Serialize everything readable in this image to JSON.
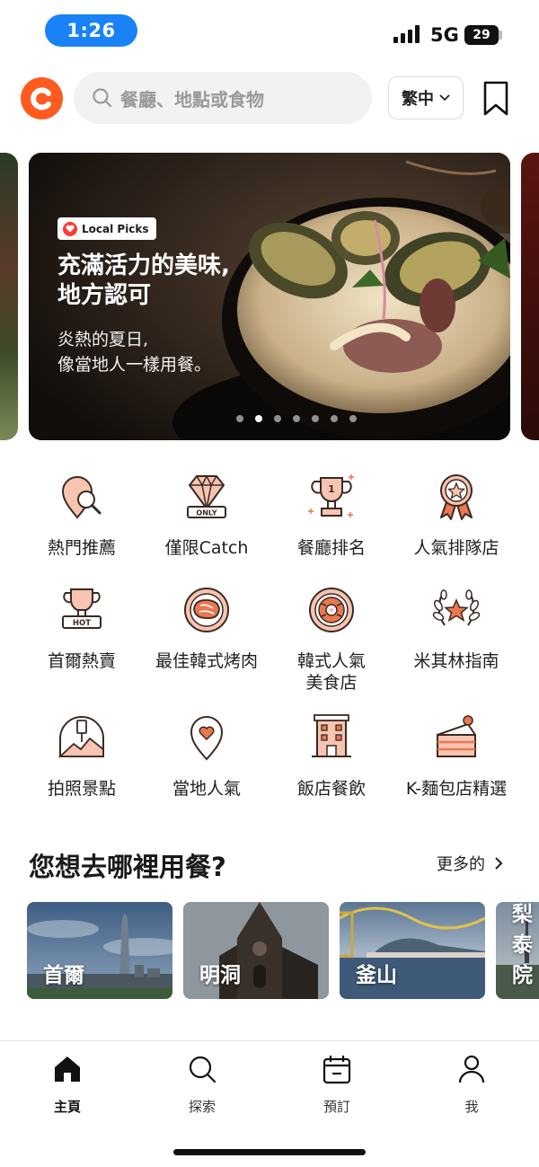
{
  "status_bar": {
    "time": "1:26",
    "network": "5G",
    "battery": "29"
  },
  "header": {
    "search_placeholder": "餐廳、地點或食物",
    "language": "繁中"
  },
  "banner": {
    "badge": "Local Picks",
    "headline": "充滿活力的美味,地方認可",
    "subtitle": "炎熱的夏日,像當地人一樣用餐。",
    "page_count": 7,
    "active_page": 2
  },
  "categories": [
    {
      "label": "熱門推薦",
      "icon": "map-pin-search-icon"
    },
    {
      "label": "僅限Catch",
      "icon": "diamond-only-icon"
    },
    {
      "label": "餐廳排名",
      "icon": "trophy-icon"
    },
    {
      "label": "人氣排隊店",
      "icon": "award-ribbon-icon"
    },
    {
      "label": "首爾熱賣",
      "icon": "hot-trophy-icon"
    },
    {
      "label": "最佳韓式烤肉",
      "icon": "steak-plate-icon"
    },
    {
      "label": "韓式人氣美食店",
      "icon": "bibimbap-icon"
    },
    {
      "label": "米其林指南",
      "icon": "laurel-star-icon"
    },
    {
      "label": "拍照景點",
      "icon": "photo-spot-icon"
    },
    {
      "label": "當地人氣",
      "icon": "heart-pin-icon"
    },
    {
      "label": "飯店餐飲",
      "icon": "hotel-icon"
    },
    {
      "label": "K-麵包店精選",
      "icon": "cake-icon"
    }
  ],
  "section": {
    "title": "您想去哪裡用餐?",
    "more": "更多的"
  },
  "cities": [
    {
      "name": "首爾"
    },
    {
      "name": "明洞"
    },
    {
      "name": "釜山"
    },
    {
      "name": "梨泰院"
    }
  ],
  "tabs": [
    {
      "label": "主頁",
      "icon": "home-icon"
    },
    {
      "label": "探索",
      "icon": "search-icon"
    },
    {
      "label": "預訂",
      "icon": "calendar-icon"
    },
    {
      "label": "我",
      "icon": "profile-icon"
    }
  ],
  "colors": {
    "accent": "#ff5a1f",
    "status_time_bg": "#1a82f7",
    "icon_orange": "#e9774f"
  }
}
